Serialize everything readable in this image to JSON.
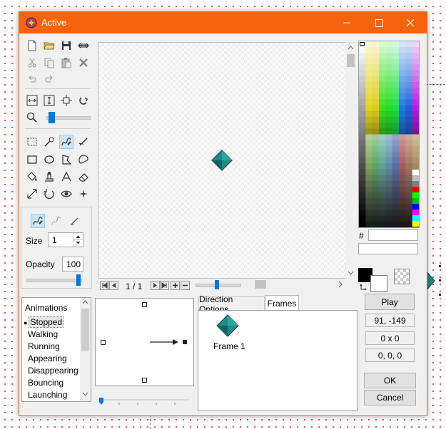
{
  "window": {
    "title": "Active"
  },
  "frame_nav": {
    "counter": "1 / 1"
  },
  "size": {
    "label": "Size",
    "value": "1"
  },
  "opacity": {
    "label": "Opacity",
    "value": "100"
  },
  "palette": {
    "hash_label": "#",
    "hex_value": "",
    "color_name": ""
  },
  "animations": {
    "header": "Animations",
    "items": [
      "Stopped",
      "Walking",
      "Running",
      "Appearing",
      "Disappearing",
      "Bouncing",
      "Launching"
    ],
    "selected_index": 0
  },
  "tabs": {
    "direction_options": "Direction Options",
    "frames": "Frames"
  },
  "frames": {
    "items": [
      "Frame 1"
    ]
  },
  "right_panel": {
    "play": "Play",
    "coordinates": "91, -149",
    "dimensions": "0 x 0",
    "rgb": "0, 0, 0",
    "ok": "OK",
    "cancel": "Cancel"
  },
  "colors": {
    "titlebar": "#f7630c",
    "accent": "#0078d7",
    "sprite": "#1f8a8a"
  }
}
